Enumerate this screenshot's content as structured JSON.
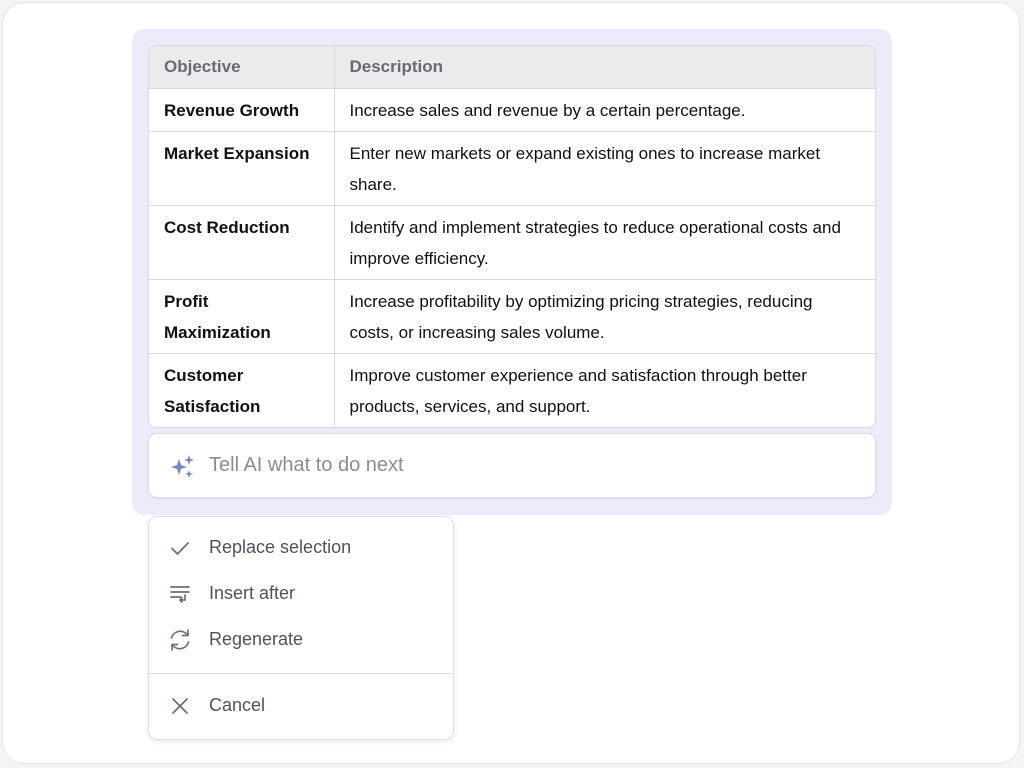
{
  "table": {
    "headers": [
      "Objective",
      "Description"
    ],
    "rows": [
      {
        "objective": "Revenue Growth",
        "description": "Increase sales and revenue by a certain percentage."
      },
      {
        "objective": "Market Expansion",
        "description": "Enter new markets or expand existing ones to increase market share."
      },
      {
        "objective": "Cost Reduction",
        "description": "Identify and implement strategies to reduce operational costs and improve efficiency."
      },
      {
        "objective": "Profit Maximization",
        "description": "Increase profitability by optimizing pricing strategies, reducing costs, or increasing sales volume."
      },
      {
        "objective": "Customer Satisfaction",
        "description": "Improve customer experience and satisfaction through better products, services, and support."
      }
    ]
  },
  "prompt": {
    "icon": "sparkle-icon",
    "placeholder": "Tell AI what to do next"
  },
  "menu": {
    "items": [
      {
        "label": "Replace selection",
        "icon": "check-icon"
      },
      {
        "label": "Insert after",
        "icon": "insert-after-icon"
      },
      {
        "label": "Regenerate",
        "icon": "refresh-icon"
      },
      {
        "label": "Cancel",
        "icon": "close-icon"
      }
    ]
  },
  "colors": {
    "panel_bg": "#ecebfc",
    "sparkle": "#7b86c9",
    "menu_text": "#4e5360"
  }
}
